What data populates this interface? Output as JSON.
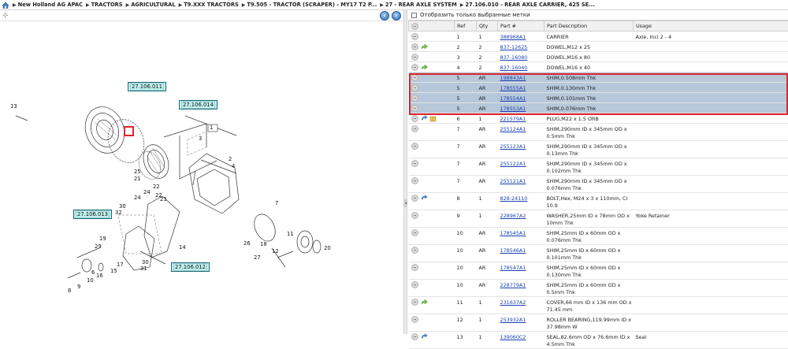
{
  "breadcrumb": {
    "items": [
      "New Holland AG APAC",
      "TRACTORS",
      "AGRICULTURAL",
      "T9.XXX TRACTORS",
      "T9.505 - TRACTOR (SCRAPER) - MY17 T2 P...",
      "27 - REAR AXLE SYSTEM",
      "27.106.010 - REAR AXLE CARRIER, 425 SE..."
    ]
  },
  "filter": {
    "label": "Отобразить только выбранные метки"
  },
  "table": {
    "headers": [
      "Ref",
      "Qty",
      "Part #",
      "Part Description",
      "Usage"
    ],
    "rows": [
      {
        "ref": "1",
        "qty": "1",
        "part": "388968A1",
        "desc": "CARRIER",
        "usage": "Axle, Incl 2 - 4",
        "icons": [
          "circle"
        ]
      },
      {
        "ref": "2",
        "qty": "2",
        "part": "837-12625",
        "desc": "DOWEL,M12 x 25",
        "usage": "",
        "icons": [
          "circle",
          "arrow"
        ]
      },
      {
        "ref": "3",
        "qty": "2",
        "part": "837-16080",
        "desc": "DOWEL,M16 x 80",
        "usage": "",
        "icons": [
          "circle"
        ]
      },
      {
        "ref": "4",
        "qty": "2",
        "part": "837-16040",
        "desc": "DOWEL,M16 x 40",
        "usage": "",
        "icons": [
          "circle",
          "arrow"
        ]
      },
      {
        "ref": "5",
        "qty": "AR",
        "part": "198843A1",
        "desc": "SHIM,0.508mm Thk",
        "usage": "",
        "icons": [
          "circle"
        ],
        "selected": true
      },
      {
        "ref": "5",
        "qty": "AR",
        "part": "178555A1",
        "desc": "SHIM,0.130mm Thk",
        "usage": "",
        "icons": [
          "circle"
        ],
        "selected": true
      },
      {
        "ref": "5",
        "qty": "AR",
        "part": "178554A1",
        "desc": "SHIM,0.101mm Thk",
        "usage": "",
        "icons": [
          "circle"
        ],
        "selected": true
      },
      {
        "ref": "5",
        "qty": "AR",
        "part": "178553A1",
        "desc": "SHIM,0.076mm Thk",
        "usage": "",
        "icons": [
          "circle"
        ],
        "selected": true
      },
      {
        "ref": "6",
        "qty": "1",
        "part": "221579A1",
        "desc": "PLUG,M22 x 1.5 ORB",
        "usage": "",
        "icons": [
          "circle",
          "info",
          "book"
        ]
      },
      {
        "ref": "7",
        "qty": "AR",
        "part": "255124A1",
        "desc": "SHIM,290mm ID x 345mm OD x 0.5mm Thk",
        "usage": "",
        "icons": [
          "circle"
        ],
        "tall": true
      },
      {
        "ref": "7",
        "qty": "AR",
        "part": "255123A1",
        "desc": "SHIM,290mm ID x 345mm OD x 0.13mm Thk",
        "usage": "",
        "icons": [
          "circle"
        ],
        "tall": true
      },
      {
        "ref": "7",
        "qty": "AR",
        "part": "255122A1",
        "desc": "SHIM,290mm ID x 345mm OD x 0.102mm Thk",
        "usage": "",
        "icons": [
          "circle"
        ],
        "tall": true
      },
      {
        "ref": "7",
        "qty": "AR",
        "part": "255121A1",
        "desc": "SHIM,290mm ID x 345mm OD x 0.076mm Thk",
        "usage": "",
        "icons": [
          "circle"
        ],
        "tall": true
      },
      {
        "ref": "8",
        "qty": "1",
        "part": "828-24110",
        "desc": "BOLT,Hex, M24 x 3 x 110mm, Cl 10.9",
        "usage": "",
        "icons": [
          "circle",
          "info"
        ]
      },
      {
        "ref": "9",
        "qty": "1",
        "part": "228967A2",
        "desc": "WASHER,25mm ID x 78mm OD x 10mm Thk",
        "usage": "Yoke Retainer",
        "icons": [
          "circle"
        ],
        "tall": true
      },
      {
        "ref": "10",
        "qty": "AR",
        "part": "178545A1",
        "desc": "SHIM,25mm ID x 60mm OD x 0.076mm Thk",
        "usage": "",
        "icons": [
          "circle"
        ],
        "tall": true
      },
      {
        "ref": "10",
        "qty": "AR",
        "part": "178546A1",
        "desc": "SHIM,25mm ID x 60mm OD x 0.101mm Thk",
        "usage": "",
        "icons": [
          "circle"
        ],
        "tall": true
      },
      {
        "ref": "10",
        "qty": "AR",
        "part": "178547A1",
        "desc": "SHIM,25mm ID x 60mm OD x 0.130mm Thk",
        "usage": "",
        "icons": [
          "circle"
        ],
        "tall": true
      },
      {
        "ref": "10",
        "qty": "AR",
        "part": "228779A1",
        "desc": "SHIM,25mm ID x 60mm OD x 0.5mm Thk",
        "usage": "",
        "icons": [
          "circle"
        ]
      },
      {
        "ref": "11",
        "qty": "1",
        "part": "231637A2",
        "desc": "COVER,66 mm ID x 136 mm OD x 71.45 mm",
        "usage": "",
        "icons": [
          "circle",
          "arrow"
        ],
        "tall": true
      },
      {
        "ref": "12",
        "qty": "1",
        "part": "253932A1",
        "desc": "ROLLER BEARING,119.99mm ID x 37.98mm W",
        "usage": "",
        "icons": [
          "circle"
        ],
        "tall": true
      },
      {
        "ref": "13",
        "qty": "1",
        "part": "139060C2",
        "desc": "SEAL,82.6mm OD x 76.6mm ID x 4.5mm Thk",
        "usage": "Seal",
        "icons": [
          "circle",
          "info"
        ],
        "tall": true
      }
    ]
  },
  "diagram": {
    "callouts": [
      "27.106.011",
      "27.106.014",
      "27.106.013",
      "27.106.012"
    ],
    "labels": [
      "13",
      "1",
      "3",
      "2",
      "4",
      "25",
      "21",
      "22",
      "24",
      "23",
      "22",
      "24",
      "30",
      "32",
      "19",
      "29",
      "7",
      "18",
      "12",
      "11",
      "20",
      "26",
      "27",
      "14",
      "30",
      "31",
      "17",
      "15",
      "16",
      "10",
      "9",
      "8",
      "6"
    ]
  },
  "colors": {
    "selection": "#b6c8da",
    "highlight_border": "#e0232d",
    "link": "#1a3fb3",
    "callout_bg": "#bff0ee"
  }
}
